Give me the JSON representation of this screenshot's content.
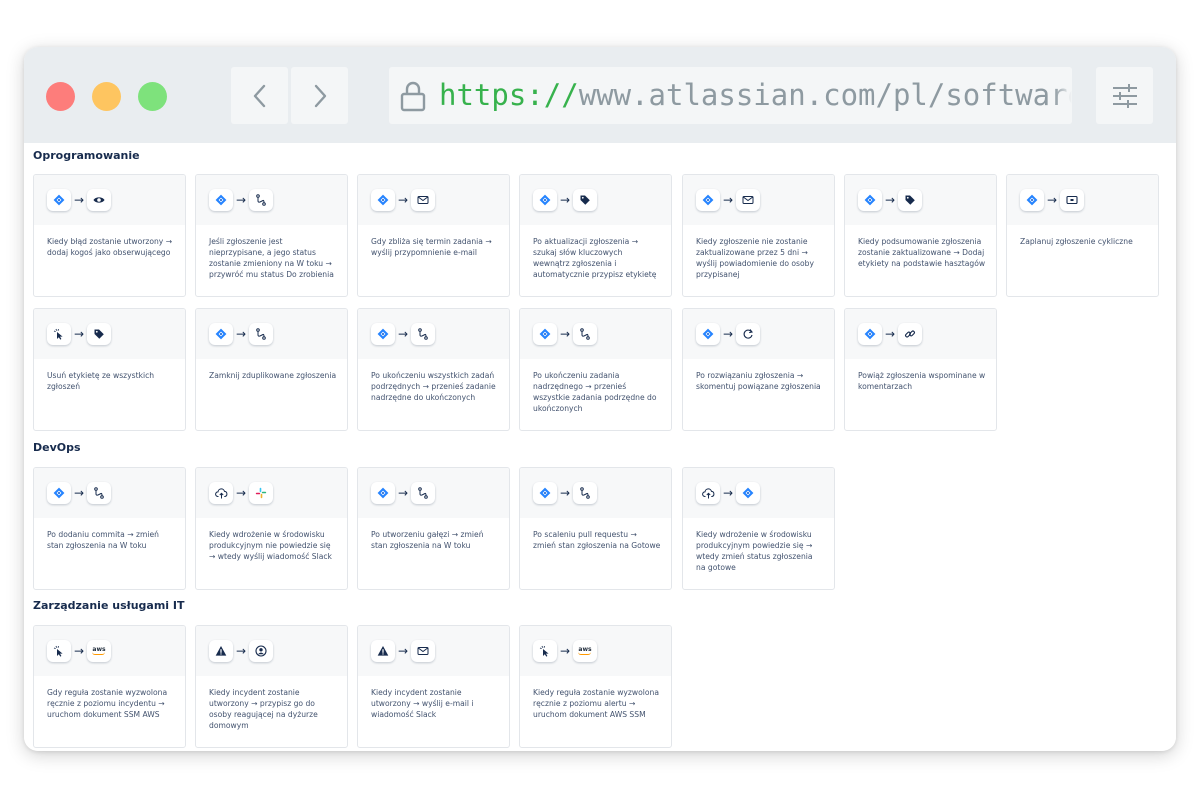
{
  "browser": {
    "url_scheme": "https://",
    "url_rest": "www.atlassian.com/pl/software"
  },
  "sections": [
    {
      "title": "Oprogramowanie",
      "cards": [
        {
          "icons": [
            "jira-icon",
            "eye-icon"
          ],
          "text": "Kiedy błąd zostanie utworzony → dodaj kogoś jako obserwującego"
        },
        {
          "icons": [
            "jira-icon",
            "branch-icon"
          ],
          "text": "Jeśli zgłoszenie jest nieprzypisane, a jego status zostanie zmieniony na W toku → przywróć mu status Do zrobienia"
        },
        {
          "icons": [
            "jira-icon",
            "mail-icon"
          ],
          "text": "Gdy zbliża się termin zadania → wyślij przypomnienie e-mail"
        },
        {
          "icons": [
            "jira-icon",
            "tag-icon"
          ],
          "text": "Po aktualizacji zgłoszenia → szukaj słów kluczowych wewnątrz zgłoszenia i automatycznie przypisz etykietę"
        },
        {
          "icons": [
            "jira-icon",
            "mail-icon"
          ],
          "text": "Kiedy zgłoszenie nie zostanie zaktualizowane przez 5 dni → wyślij powiadomienie do osoby przypisanej"
        },
        {
          "icons": [
            "jira-icon",
            "tag-icon"
          ],
          "text": "Kiedy podsumowanie zgłoszenia zostanie zaktualizowane → Dodaj etykiety na podstawie hasztagów"
        },
        {
          "icons": [
            "jira-icon",
            "ticket-icon"
          ],
          "text": "Zaplanuj zgłoszenie cykliczne"
        },
        {
          "icons": [
            "cursor-click-icon",
            "tag-icon"
          ],
          "text": "Usuń etykietę ze wszystkich zgłoszeń"
        },
        {
          "icons": [
            "jira-icon",
            "branch-icon"
          ],
          "text": "Zamknij zduplikowane zgłoszenia"
        },
        {
          "icons": [
            "jira-icon",
            "branch-icon"
          ],
          "text": "Po ukończeniu wszystkich zadań podrzędnych → przenieś zadanie nadrzędne do ukończonych"
        },
        {
          "icons": [
            "jira-icon",
            "branch-icon"
          ],
          "text": "Po ukończeniu zadania nadrzędnego → przenieś wszystkie zadania podrzędne do ukończonych"
        },
        {
          "icons": [
            "jira-icon",
            "refresh-icon"
          ],
          "text": "Po rozwiązaniu zgłoszenia → skomentuj powiązane zgłoszenia"
        },
        {
          "icons": [
            "jira-icon",
            "link-icon"
          ],
          "text": "Powiąż zgłoszenia wspominane w komentarzach"
        }
      ]
    },
    {
      "title": "DevOps",
      "cards": [
        {
          "icons": [
            "jira-icon",
            "branch-icon"
          ],
          "text": "Po dodaniu commita → zmień stan zgłoszenia na W toku"
        },
        {
          "icons": [
            "cloud-upload-icon",
            "slack-icon"
          ],
          "text": "Kiedy wdrożenie w środowisku produkcyjnym nie powiedzie się → wtedy wyślij wiadomość Slack"
        },
        {
          "icons": [
            "jira-icon",
            "branch-icon"
          ],
          "text": "Po utworzeniu gałęzi → zmień stan zgłoszenia na W toku"
        },
        {
          "icons": [
            "jira-icon",
            "branch-icon"
          ],
          "text": "Po scaleniu pull requestu → zmień stan zgłoszenia na Gotowe"
        },
        {
          "icons": [
            "cloud-upload-icon",
            "jira-icon"
          ],
          "text": "Kiedy wdrożenie w środowisku produkcyjnym powiedzie się → wtedy zmień status zgłoszenia na gotowe"
        }
      ]
    },
    {
      "title": "Zarządzanie usługami IT",
      "cards": [
        {
          "icons": [
            "cursor-click-icon",
            "aws-icon"
          ],
          "text": "Gdy reguła zostanie wyzwolona ręcznie z poziomu incydentu → uruchom dokument SSM AWS"
        },
        {
          "icons": [
            "warning-icon",
            "user-icon"
          ],
          "text": "Kiedy incydent zostanie utworzony → przypisz go do osoby reagującej na dyżurze domowym"
        },
        {
          "icons": [
            "warning-icon",
            "mail-icon"
          ],
          "text": "Kiedy incydent zostanie utworzony → wyślij e-mail i wiadomość Slack"
        },
        {
          "icons": [
            "cursor-click-icon",
            "aws-icon"
          ],
          "text": "Kiedy reguła zostanie wyzwolona ręcznie z poziomu alertu → uruchom dokument AWS SSM"
        }
      ]
    }
  ],
  "arrow_glyph": "→",
  "aws_label": "aws",
  "colors": {
    "jira_blue": "#2684ff",
    "titlebar": "#e9edf0",
    "url_scheme": "#37b24d",
    "card_text": "#42526e"
  }
}
